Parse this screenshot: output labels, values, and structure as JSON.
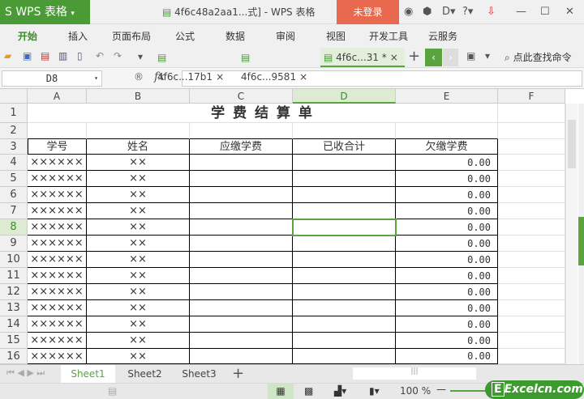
{
  "app": {
    "logo": "S WPS 表格",
    "title": "4f6c48a2aa1...式] - WPS 表格",
    "login": "未登录"
  },
  "menu": [
    "开始",
    "插入",
    "页面布局",
    "公式",
    "数据",
    "审阅",
    "视图",
    "开发工具",
    "云服务"
  ],
  "doc_tabs": [
    "4f6c...17b1",
    "4f6c...9581",
    "4f6c...31 *"
  ],
  "search_label": "点此查找命令",
  "name_box": "D8",
  "fx": "fx",
  "formula": "",
  "columns": [
    "A",
    "B",
    "C",
    "D",
    "E",
    "F"
  ],
  "selected_cell": "D8",
  "sheet": {
    "title": "学 费 结 算 单",
    "headers": [
      "学号",
      "姓名",
      "应缴学费",
      "已收合计",
      "欠缴学费"
    ],
    "rows": [
      [
        "××××××",
        "××",
        "",
        "",
        "0.00"
      ],
      [
        "××××××",
        "××",
        "",
        "",
        "0.00"
      ],
      [
        "××××××",
        "××",
        "",
        "",
        "0.00"
      ],
      [
        "××××××",
        "××",
        "",
        "",
        "0.00"
      ],
      [
        "××××××",
        "××",
        "",
        "",
        "0.00"
      ],
      [
        "××××××",
        "××",
        "",
        "",
        "0.00"
      ],
      [
        "××××××",
        "××",
        "",
        "",
        "0.00"
      ],
      [
        "××××××",
        "××",
        "",
        "",
        "0.00"
      ],
      [
        "××××××",
        "××",
        "",
        "",
        "0.00"
      ],
      [
        "××××××",
        "××",
        "",
        "",
        "0.00"
      ],
      [
        "××××××",
        "××",
        "",
        "",
        "0.00"
      ],
      [
        "××××××",
        "××",
        "",
        "",
        "0.00"
      ],
      [
        "××××××",
        "××",
        "",
        "",
        "0.00"
      ]
    ]
  },
  "sheet_tabs": [
    "Sheet1",
    "Sheet2",
    "Sheet3"
  ],
  "zoom": "100 %",
  "watermark": "Excelcn.com",
  "colors": {
    "accent": "#4a9a36",
    "login": "#e8694e"
  }
}
